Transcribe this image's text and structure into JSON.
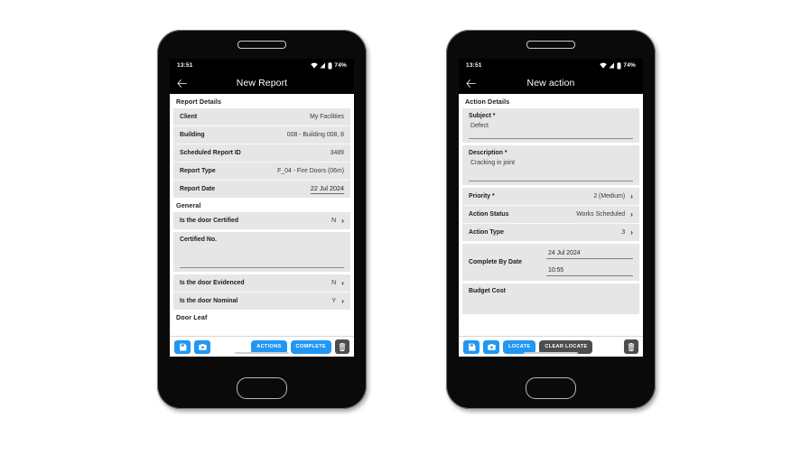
{
  "phones": [
    {
      "id": "left",
      "status_bar": {
        "time": "13:51",
        "battery": "74%",
        "icons": [
          "wifi-icon",
          "signal-icon",
          "battery-icon"
        ]
      },
      "app_bar": {
        "back": "←",
        "title": "New Report"
      },
      "sections": [
        {
          "header": "Report Details"
        },
        {
          "header": "General"
        },
        {
          "header": "Door Leaf"
        }
      ],
      "report_details": {
        "rows": [
          {
            "label": "Client",
            "value": "My Facilities"
          },
          {
            "label": "Building",
            "value": "008 - Building 008, 8"
          },
          {
            "label": "Scheduled Report ID",
            "value": "3489"
          },
          {
            "label": "Report Type",
            "value": "F_04 - Fire Doors (06m)"
          },
          {
            "label": "Report Date",
            "value": "22 Jul 2024"
          }
        ]
      },
      "general": {
        "certified_row": {
          "label": "Is the door Certified",
          "value": "N",
          "chevron": "›"
        },
        "certified_no": {
          "label": "Certified No.",
          "value": ""
        },
        "evidenced_row": {
          "label": "Is the door Evidenced",
          "value": "N",
          "chevron": "›"
        },
        "nominal_row": {
          "label": "Is the door Nominal",
          "value": "Y",
          "chevron": "›"
        }
      },
      "toolbar": {
        "save": "save-icon",
        "camera": "camera-icon",
        "actions_label": "ACTIONS",
        "complete_label": "COMPLETE",
        "delete": "trash-icon"
      }
    },
    {
      "id": "right",
      "status_bar": {
        "time": "13:51",
        "battery": "74%",
        "icons": [
          "wifi-icon",
          "signal-icon",
          "battery-icon"
        ]
      },
      "app_bar": {
        "back": "←",
        "title": "New action"
      },
      "sections": [
        {
          "header": "Action Details"
        }
      ],
      "action_details": {
        "subject": {
          "label": "Subject *",
          "value": "Defect"
        },
        "description": {
          "label": "Description *",
          "value": "Cracking in joint"
        },
        "rows": [
          {
            "label": "Priority *",
            "value": "2 (Medium)",
            "chevron": "›"
          },
          {
            "label": "Action Status",
            "value": "Works Scheduled",
            "chevron": "›"
          },
          {
            "label": "Action Type",
            "value": "3",
            "chevron": "›"
          }
        ],
        "complete_by": {
          "label": "Complete By Date",
          "date": "24 Jul 2024",
          "time": "10:55"
        },
        "budget_cost": {
          "label": "Budget Cost",
          "value": ""
        }
      },
      "toolbar": {
        "save": "save-icon",
        "camera": "camera-icon",
        "locate_label": "LOCATE",
        "clear_locate_label": "CLEAR LOCATE",
        "delete": "trash-icon"
      }
    }
  ],
  "colors": {
    "accent": "#2196f3",
    "dark_button": "#4d4d4d",
    "field_bg": "#e6e6e6",
    "appbar_bg": "#000000"
  }
}
